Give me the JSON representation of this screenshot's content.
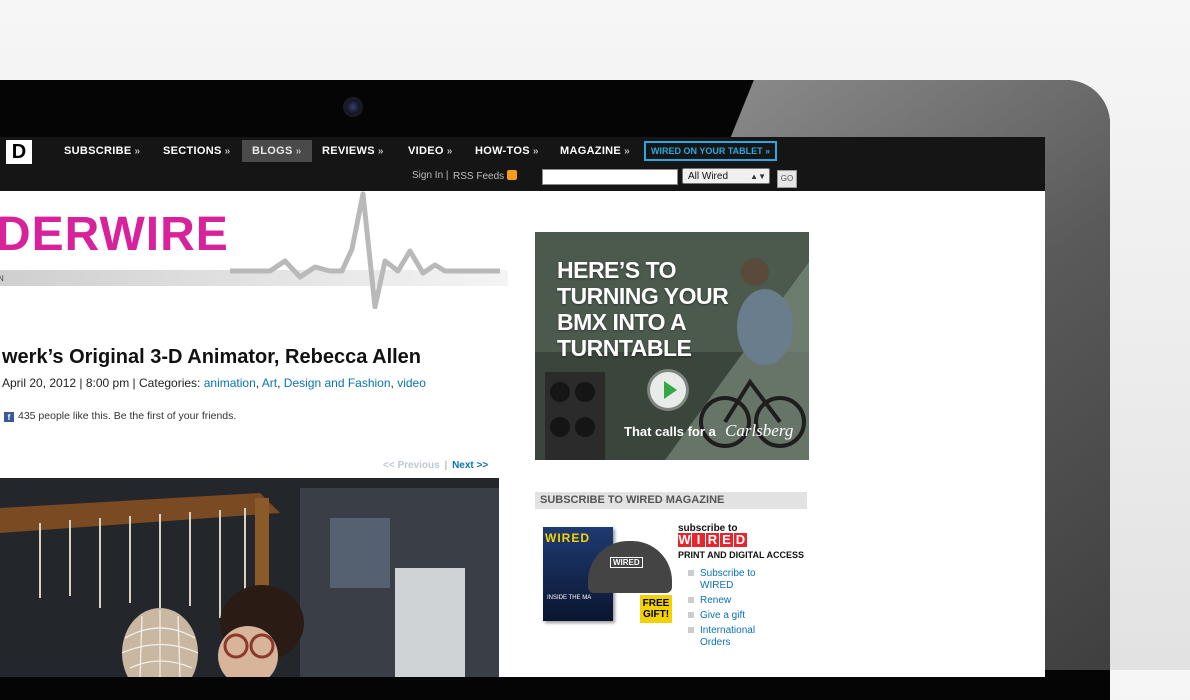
{
  "nav": {
    "logo": "D",
    "items": [
      {
        "label": "SUBSCRIBE",
        "arrow": "»"
      },
      {
        "label": "SECTIONS",
        "arrow": "»"
      },
      {
        "label": "BLOGS",
        "arrow": "»"
      },
      {
        "label": "REVIEWS",
        "arrow": "»"
      },
      {
        "label": "VIDEO",
        "arrow": "»"
      },
      {
        "label": "HOW-TOS",
        "arrow": "»"
      },
      {
        "label": "MAGAZINE",
        "arrow": "»"
      }
    ],
    "tablet_link": "WIRED ON YOUR TABLET »",
    "sign_in": "Sign In",
    "sign_sep": "|",
    "rss": "RSS Feeds",
    "search_value": "",
    "search_scope": "All Wired",
    "go": "GO"
  },
  "blog": {
    "masthead": "DERWIRE",
    "sub": "N"
  },
  "article": {
    "title": "werk’s Original 3-D Animator, Rebecca Allen",
    "date": "April 20, 2012",
    "time": "8:00 pm",
    "categories_label": "Categories:",
    "categories": [
      "animation",
      "Art",
      "Design and Fashion",
      "video"
    ],
    "facebook_text": "435 people like this. Be the first of your friends.",
    "prev": "<< Previous",
    "pager_sep": "|",
    "next": "Next >>"
  },
  "ad": {
    "headline_1": "HERE’S TO",
    "headline_2": "TURNING YOUR",
    "headline_3": "BMX INTO A",
    "headline_4": "TURNTABLE",
    "tagline": "That calls for a",
    "brand": "Carlsberg"
  },
  "subscribe": {
    "header": "SUBSCRIBE TO WIRED MAGAZINE",
    "mag_logo": "WIRED",
    "mag_inside": "INSIDE THE MA",
    "cap_logo": "WIRED",
    "free_gift_1": "FREE",
    "free_gift_2": "GIFT!",
    "subscribe_to": "subscribe to",
    "wired_letters": [
      "W",
      "I",
      "R",
      "E",
      "D"
    ],
    "print_digital": "PRINT AND DIGITAL ACCESS",
    "links": [
      "Subscribe to WIRED",
      "Renew",
      "Give a gift",
      "International Orders"
    ]
  },
  "colors": {
    "accent_link": "#0a72b3",
    "masthead_pink": "#d8229c",
    "tablet_blue": "#2aa8e0",
    "wired_red": "#e5262e"
  }
}
